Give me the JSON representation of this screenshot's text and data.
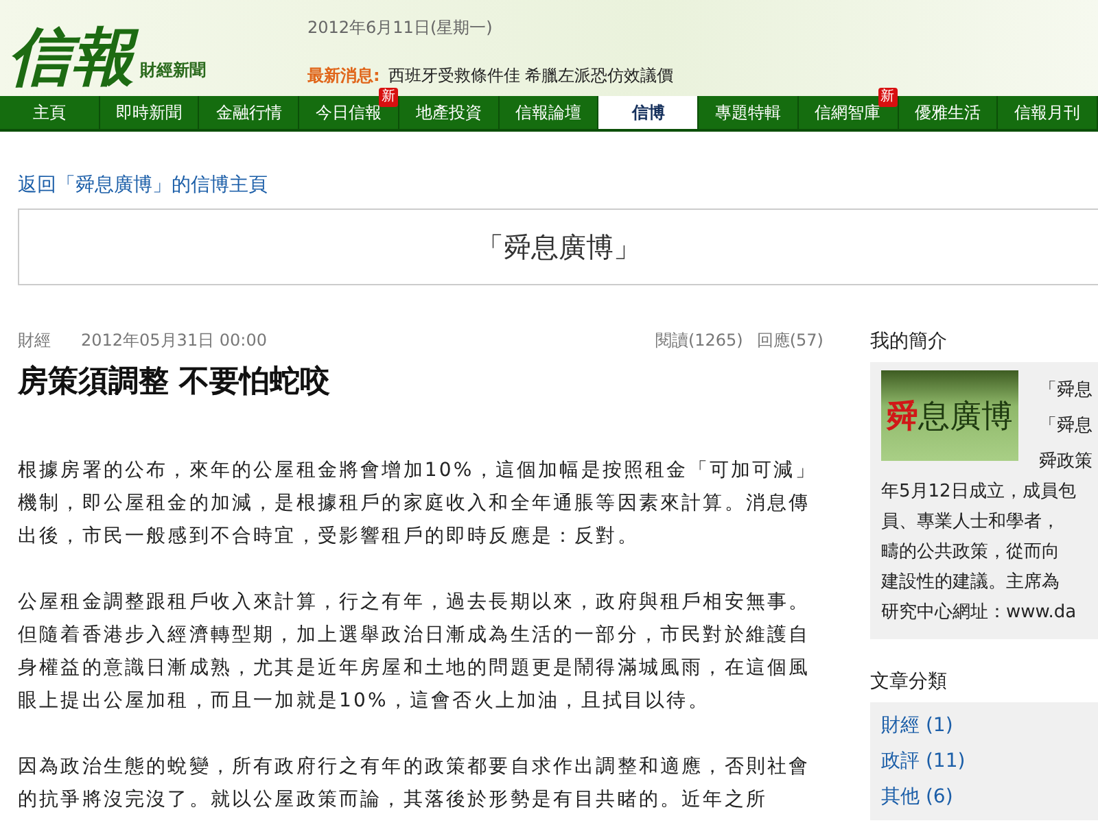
{
  "header": {
    "logo": "信報",
    "logo_sub": "財經新聞",
    "date": "2012年6月11日(星期一)",
    "news_label": "最新消息:",
    "news_text": "西班牙受救條件佳 希臘左派恐仿效議價"
  },
  "nav": [
    {
      "label": "主頁",
      "selected": false
    },
    {
      "label": "即時新聞",
      "selected": false
    },
    {
      "label": "金融行情",
      "selected": false
    },
    {
      "label": "今日信報",
      "selected": false,
      "badge": "新"
    },
    {
      "label": "地產投資",
      "selected": false
    },
    {
      "label": "信報論壇",
      "selected": false
    },
    {
      "label": "信博",
      "selected": true
    },
    {
      "label": "專題特輯",
      "selected": false
    },
    {
      "label": "信網智庫",
      "selected": false,
      "badge": "新"
    },
    {
      "label": "優雅生活",
      "selected": false
    },
    {
      "label": "信報月刊",
      "selected": false
    }
  ],
  "back_link": "返回「舜息廣博」的信博主頁",
  "blog_title": "「舜息廣博」",
  "article": {
    "category": "財經",
    "date": "2012年05月31日 00:00",
    "reads": "閱讀(1265)",
    "replies": "回應(57)",
    "title": "房策須調整 不要怕蛇咬",
    "paragraphs": [
      "根據房署的公布，來年的公屋租金將會增加10%，這個加幅是按照租金「可加可減」機制，即公屋租金的加減，是根據租戶的家庭收入和全年通脹等因素來計算。消息傳出後，市民一般感到不合時宜，受影響租戶的即時反應是：反對。",
      "公屋租金調整跟租戶收入來計算，行之有年，過去長期以來，政府與租戶相安無事。但隨着香港步入經濟轉型期，加上選舉政治日漸成為生活的一部分，市民對於維護自身權益的意識日漸成熟，尤其是近年房屋和土地的問題更是鬧得滿城風雨，在這個風眼上提出公屋加租，而且一加就是10%，這會否火上加油，且拭目以待。",
      "因為政治生態的蛻變，所有政府行之有年的政策都要自求作出調整和適應，否則社會的抗爭將沒完沒了。就以公屋政策而論，其落後於形勢是有目共睹的。近年之所"
    ]
  },
  "profile": {
    "heading": "我的簡介",
    "logo_mark": "舜",
    "logo_rest": "息廣博",
    "side_lines": [
      "「舜息",
      "「舜息",
      "舜政策"
    ],
    "lines": [
      "年5月12日成立，成員包",
      "員、專業人士和學者，",
      "疇的公共政策，從而向",
      "建設性的建議。主席為",
      "研究中心網址：www.da"
    ]
  },
  "categories": {
    "heading": "文章分類",
    "items": [
      "財經 (1)",
      "政評 (11)",
      "其他 (6)"
    ]
  }
}
